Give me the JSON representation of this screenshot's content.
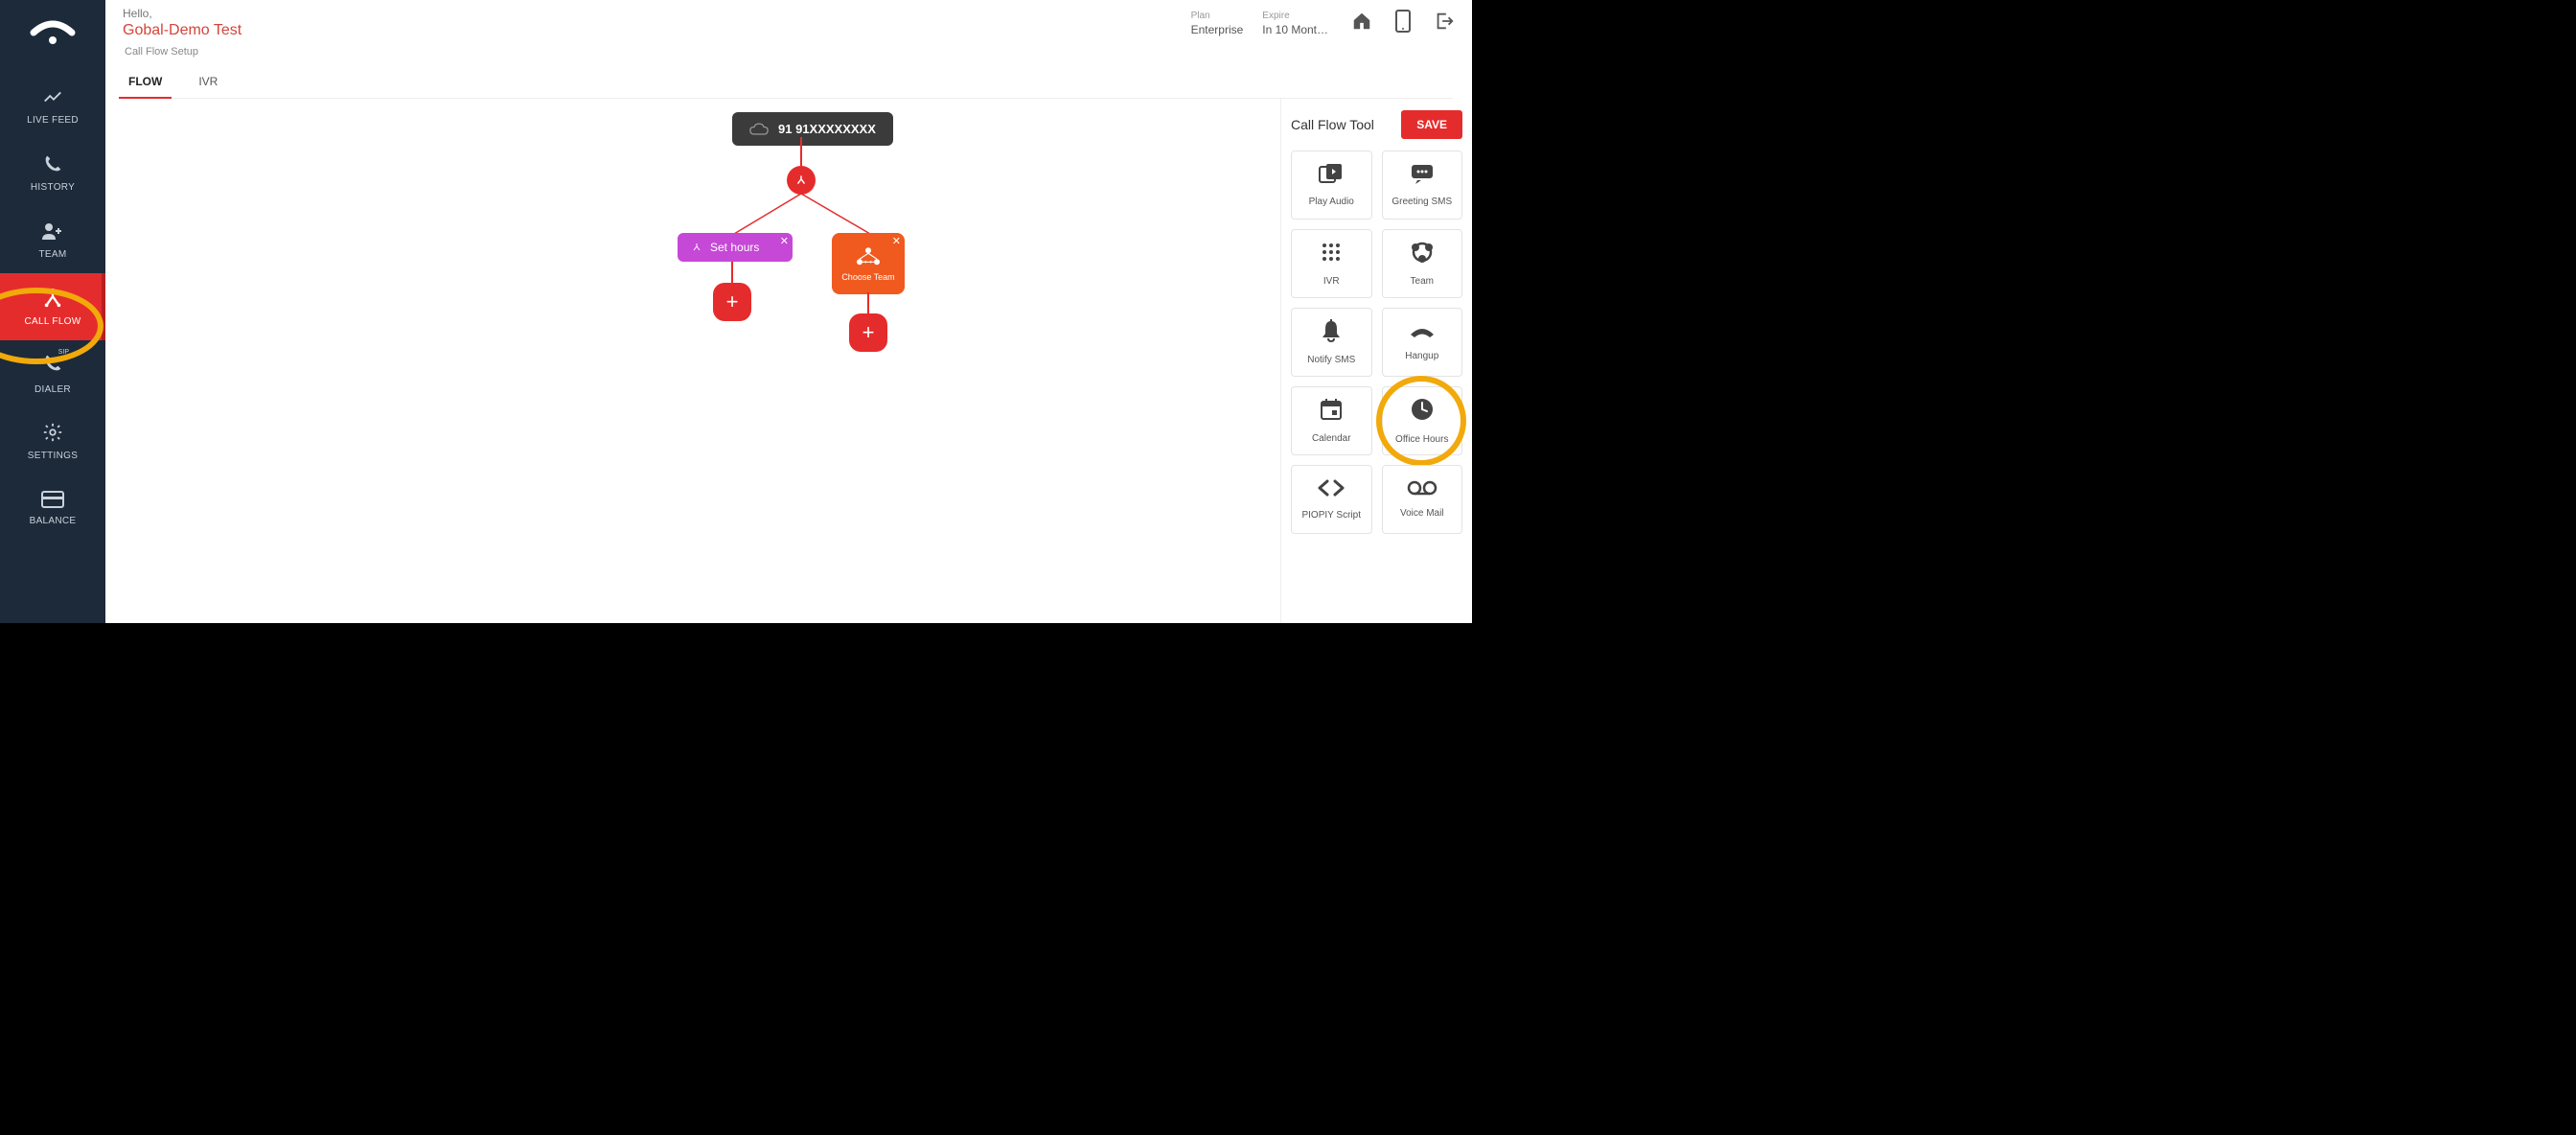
{
  "header": {
    "hello": "Hello,",
    "brand": "Gobal-Demo Test",
    "plan_label": "Plan",
    "plan_value": "Enterprise",
    "expire_label": "Expire",
    "expire_value": "In 10 Mont…"
  },
  "sidebar": {
    "items": [
      {
        "icon": "trend",
        "label": "LIVE FEED"
      },
      {
        "icon": "phone",
        "label": "HISTORY"
      },
      {
        "icon": "team",
        "label": "TEAM"
      },
      {
        "icon": "flow",
        "label": "CALL FLOW"
      },
      {
        "icon": "dialer",
        "label": "DIALER"
      },
      {
        "icon": "gear",
        "label": "SETTINGS"
      },
      {
        "icon": "card",
        "label": "BALANCE"
      }
    ]
  },
  "sub": {
    "title": "Call Flow Setup",
    "tabs": [
      {
        "label": "FLOW"
      },
      {
        "label": "IVR"
      }
    ]
  },
  "flow": {
    "number": "91 91XXXXXXXX",
    "set_hours": "Set hours",
    "choose_team": "Choose Team"
  },
  "panel": {
    "title": "Call Flow Tool",
    "save": "SAVE",
    "tools": [
      {
        "label": "Play Audio",
        "icon": "play-audio"
      },
      {
        "label": "Greeting SMS",
        "icon": "sms"
      },
      {
        "label": "IVR",
        "icon": "dialpad"
      },
      {
        "label": "Team",
        "icon": "team-circle"
      },
      {
        "label": "Notify SMS",
        "icon": "bell"
      },
      {
        "label": "Hangup",
        "icon": "hangup"
      },
      {
        "label": "Calendar",
        "icon": "calendar"
      },
      {
        "label": "Office Hours",
        "icon": "clock"
      },
      {
        "label": "PIOPIY Script",
        "icon": "code"
      },
      {
        "label": "Voice Mail",
        "icon": "voicemail"
      }
    ]
  }
}
